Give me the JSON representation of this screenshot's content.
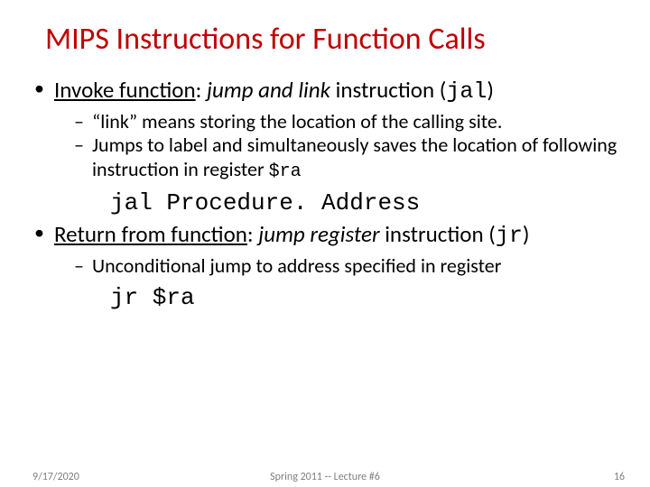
{
  "title": "MIPS Instructions for Function Calls",
  "bullets": {
    "b1_pre": "Invoke function",
    "b1_mid": "jump and link",
    "b1_post": " instruction (",
    "b1_code": "jal",
    "b1_end": ")",
    "b1s1": "“link” means storing the location of the calling site.",
    "b1s2": "Jumps to label and simultaneously saves the location of following instruction in register ",
    "b1s2_code": "$ra",
    "code1": "jal Procedure. Address",
    "b2_pre": "Return from function",
    "b2_mid": "jump register",
    "b2_post": " instruction (",
    "b2_code": "jr",
    "b2_end": ")",
    "b2s1": "Unconditional jump to address specified in register",
    "code2": "jr $ra"
  },
  "footer": {
    "date": "9/17/2020",
    "center": "Spring 2011 -- Lecture #6",
    "page": "16"
  }
}
